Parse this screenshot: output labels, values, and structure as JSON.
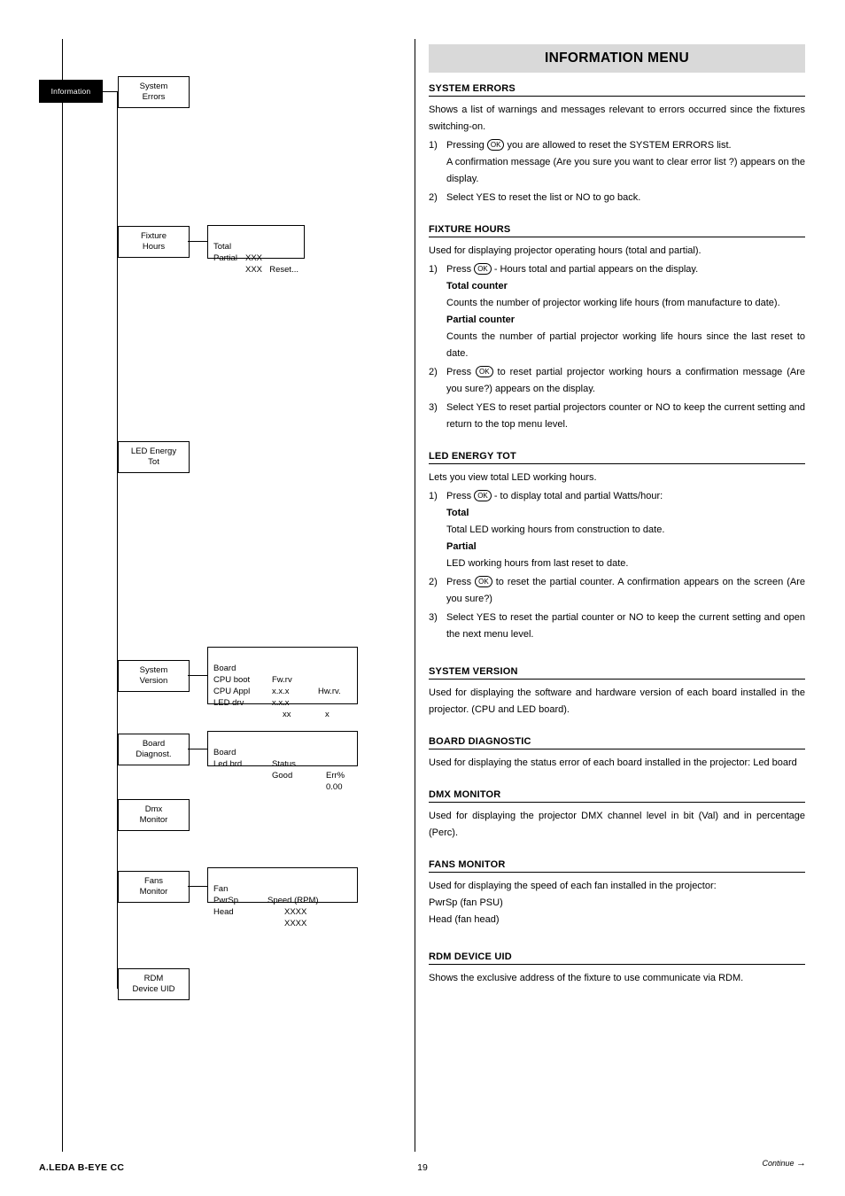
{
  "document": {
    "footer_left": "A.LEDA B-EYE CC",
    "page_number": "19",
    "continue_label": "Continue",
    "continue_arrow": "→"
  },
  "diagram": {
    "root_label": "Information",
    "nodes": [
      {
        "line1": "System",
        "line2": "Errors"
      },
      {
        "line1": "Fixture",
        "line2": "Hours"
      },
      {
        "line1": "LED Energy",
        "line2": "Tot"
      },
      {
        "line1": "System",
        "line2": "Version"
      },
      {
        "line1": "Board",
        "line2": "Diagnost."
      },
      {
        "line1": "Dmx",
        "line2": "Monitor"
      },
      {
        "line1": "Fans",
        "line2": "Monitor"
      },
      {
        "line1": "RDM",
        "line2": "Device UID"
      }
    ],
    "detail_fixture_hours": {
      "rows": [
        {
          "c1": "Total",
          "c2": "XXX"
        },
        {
          "c1": "Partial",
          "c2": "XXX"
        }
      ],
      "reset": "Reset..."
    },
    "detail_system_version": {
      "header": {
        "c1": "Board",
        "c2": "Fw.rv",
        "c3": "Hw.rv."
      },
      "rows": [
        {
          "c1": "CPU boot",
          "c2": "x.x.x",
          "c3": ""
        },
        {
          "c1": "CPU Appl",
          "c2": "x.x.x",
          "c3": "x"
        },
        {
          "c1": "LED drv",
          "c2": "xx",
          "c3": ""
        }
      ]
    },
    "detail_board_diagnostic": {
      "header": {
        "c1": "Board",
        "c2": "Status",
        "c3": "Err%"
      },
      "rows": [
        {
          "c1": "Led brd",
          "c2": "Good",
          "c3": "0.00"
        }
      ]
    },
    "detail_fans_monitor": {
      "header": {
        "c1": "Fan",
        "c2": "Speed (RPM)"
      },
      "rows": [
        {
          "c1": "PwrSp",
          "c2": "XXXX"
        },
        {
          "c1": "Head",
          "c2": "XXXX"
        }
      ]
    }
  },
  "menu": {
    "title": "INFORMATION MENU",
    "sections": [
      {
        "heading": "SYSTEM ERRORS",
        "intro": "Shows a list of warnings and messages relevant to errors occurred since the fixtures switching-on.",
        "items": [
          {
            "marker": "1)",
            "pre": "Pressing",
            "ok": "OK",
            "post": "you are allowed to reset the SYSTEM ERRORS list.",
            "extra": "A confirmation message (Are you sure you want to clear error list ?) appears on the display."
          },
          {
            "marker": "2)",
            "text": "Select YES to reset the list or NO to go back."
          }
        ]
      },
      {
        "heading": "FIXTURE HOURS",
        "intro": "Used for displaying projector operating hours (total and partial).",
        "items": [
          {
            "marker": "1)",
            "pre": "Press",
            "ok": "OK",
            "post": "- Hours total and partial appears on the display."
          },
          {
            "marker": "2)",
            "pre": "Press",
            "ok": "OK",
            "post": "to reset partial projector working hours a confirmation message (Are you sure?) appears on the display."
          },
          {
            "marker": "3)",
            "text": "Select YES to reset partial projectors counter or NO to keep the current setting and return to the top menu level."
          }
        ],
        "subs": [
          {
            "bold": "Total counter",
            "text": "Counts the number of projector working life hours (from manufacture to date)."
          },
          {
            "bold": "Partial counter",
            "text": "Counts the number of partial projector working life hours since the last reset to date."
          }
        ]
      },
      {
        "heading": "LED ENERGY TOT",
        "intro": "Lets you view total LED working hours.",
        "items": [
          {
            "marker": "1)",
            "pre": "Press",
            "ok": "OK",
            "post": "- to display total and partial Watts/hour:"
          },
          {
            "marker": "2)",
            "pre": "Press",
            "ok": "OK",
            "post": "to reset the partial counter. A confirmation appears on the screen (Are you sure?)"
          },
          {
            "marker": "3)",
            "text": "Select YES to reset the partial counter or NO to keep the current setting and open the next menu level."
          }
        ],
        "subs": [
          {
            "bold": "Total",
            "text": "Total LED working hours from construction to date."
          },
          {
            "bold": "Partial",
            "text": "LED working hours from last reset to date."
          }
        ]
      },
      {
        "heading": "SYSTEM VERSION",
        "intro": "Used for displaying the software and hardware version of each board installed in the projector. (CPU and LED board)."
      },
      {
        "heading": "BOARD DIAGNOSTIC",
        "intro": "Used for displaying the status error of each board installed in the projector: Led board"
      },
      {
        "heading": "DMX MONITOR",
        "intro": "Used for displaying the projector DMX channel level in bit (Val) and in percentage (Perc)."
      },
      {
        "heading": "FANS MONITOR",
        "intro": "Used for displaying the speed of each fan installed in the projector:",
        "lines": [
          "PwrSp (fan PSU)",
          "Head (fan head)"
        ]
      },
      {
        "heading": "RDM DEVICE UID",
        "intro": "Shows the exclusive address of the fixture to use communicate via RDM."
      }
    ]
  }
}
